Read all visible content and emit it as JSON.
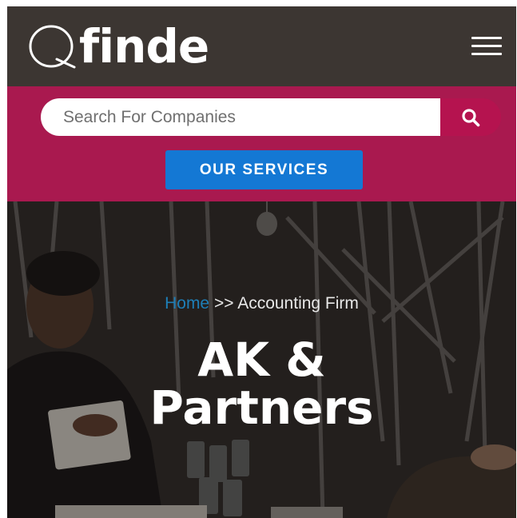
{
  "header": {
    "logo_text": "finde",
    "logo_letter": "Q",
    "menu_icon": "hamburger-menu-icon"
  },
  "search": {
    "placeholder": "Search For Companies",
    "button_icon": "search-icon"
  },
  "services_button": {
    "label": "OUR SERVICES"
  },
  "breadcrumb": {
    "home": "Home",
    "separator": ">>",
    "current": "Accounting Firm"
  },
  "hero": {
    "title_line1": "AK &",
    "title_line2": "Partners"
  },
  "colors": {
    "header_bg": "#3c3632",
    "search_band": "#a9194f",
    "services_button": "#1478d4",
    "breadcrumb_link": "#1e7fb8"
  }
}
